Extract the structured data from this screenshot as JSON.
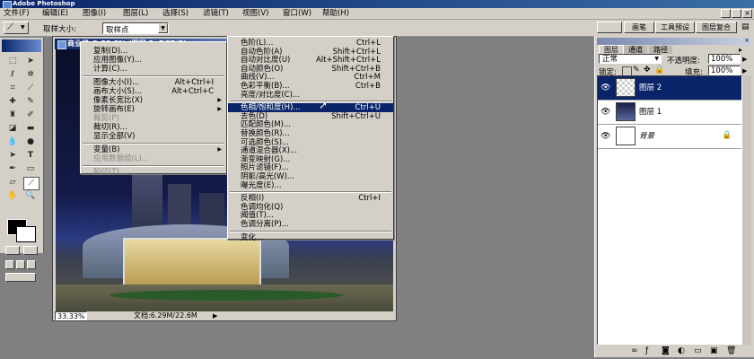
{
  "app": {
    "title": "Adobe Photoshop"
  },
  "menubar": [
    "文件(F)",
    "编辑(E)",
    "图像(I)",
    "图层(L)",
    "选择(S)",
    "滤镜(T)",
    "视图(V)",
    "窗口(W)",
    "帮助(H)"
  ],
  "options": {
    "sample_label": "取样大小:",
    "sample_value": "取样点"
  },
  "palette_well_tabs": [
    "画笔",
    "工具预设",
    "图层复合"
  ],
  "document": {
    "title": "商业楼 @ 33.3% (图层 2, RGB/8)",
    "zoom": "33.33%",
    "doc_size": "文档:6.29M/22.6M"
  },
  "image_menu": [
    {
      "label": "复制(D)...",
      "disabled": false
    },
    {
      "label": "应用图像(Y)...",
      "disabled": false
    },
    {
      "label": "计算(C)...",
      "disabled": false
    },
    {
      "sep": true
    },
    {
      "label": "图像大小(I)...",
      "shortcut": "Alt+Ctrl+I",
      "disabled": false
    },
    {
      "label": "画布大小(S)...",
      "shortcut": "Alt+Ctrl+C",
      "disabled": false
    },
    {
      "label": "像素长宽比(X)",
      "arrow": true,
      "disabled": false
    },
    {
      "label": "旋转画布(E)",
      "arrow": true,
      "disabled": false
    },
    {
      "label": "裁剪(P)",
      "disabled": true
    },
    {
      "label": "裁切(R)...",
      "disabled": false
    },
    {
      "label": "显示全部(V)",
      "disabled": false
    },
    {
      "sep": true
    },
    {
      "label": "变量(B)",
      "arrow": true,
      "disabled": false
    },
    {
      "label": "应用数据组(L)...",
      "disabled": true
    },
    {
      "sep": true
    },
    {
      "label": "陷印(T)...",
      "disabled": true
    }
  ],
  "adjust_menu": [
    {
      "label": "色阶(L)...",
      "shortcut": "Ctrl+L"
    },
    {
      "label": "自动色阶(A)",
      "shortcut": "Shift+Ctrl+L"
    },
    {
      "label": "自动对比度(U)",
      "shortcut": "Alt+Shift+Ctrl+L"
    },
    {
      "label": "自动颜色(O)",
      "shortcut": "Shift+Ctrl+B"
    },
    {
      "label": "曲线(V)...",
      "shortcut": "Ctrl+M"
    },
    {
      "label": "色彩平衡(B)...",
      "shortcut": "Ctrl+B"
    },
    {
      "label": "亮度/对比度(C)..."
    },
    {
      "sep": true
    },
    {
      "label": "色相/饱和度(H)...",
      "shortcut": "Ctrl+U",
      "highlight": true
    },
    {
      "label": "去色(D)",
      "shortcut": "Shift+Ctrl+U"
    },
    {
      "label": "匹配颜色(M)..."
    },
    {
      "label": "替换颜色(R)..."
    },
    {
      "label": "可选颜色(S)..."
    },
    {
      "label": "通道混合器(X)..."
    },
    {
      "label": "渐变映射(G)..."
    },
    {
      "label": "照片滤镜(F)..."
    },
    {
      "label": "阴影/高光(W)..."
    },
    {
      "label": "曝光度(E)..."
    },
    {
      "sep": true
    },
    {
      "label": "反相(I)",
      "shortcut": "Ctrl+I"
    },
    {
      "label": "色调均化(Q)"
    },
    {
      "label": "阈值(T)..."
    },
    {
      "label": "色调分离(P)..."
    },
    {
      "sep": true
    },
    {
      "label": "变化..."
    }
  ],
  "layers_panel": {
    "tabs": [
      "图层",
      "通道",
      "路径"
    ],
    "blend_mode": "正常",
    "opacity_label": "不透明度:",
    "opacity": "100%",
    "lock_label": "锁定:",
    "fill_label": "填充:",
    "fill": "100%",
    "layers": [
      {
        "name": "图层 2",
        "selected": true
      },
      {
        "name": "图层 1",
        "selected": false
      },
      {
        "name": "背景",
        "selected": false,
        "italic": true
      }
    ]
  },
  "colors": {
    "accent": "#0a246a",
    "chrome": "#d4d0c8",
    "workspace": "#808080"
  }
}
